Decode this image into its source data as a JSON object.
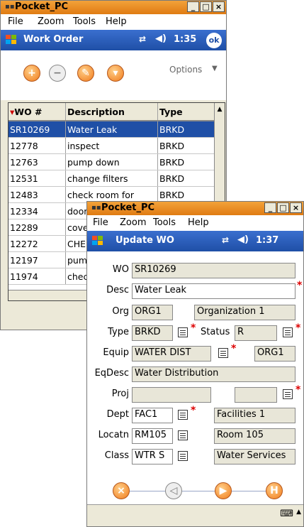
{
  "back_window": {
    "title": "Pocket_PC",
    "menu": [
      "File",
      "Zoom",
      "Tools",
      "Help"
    ],
    "nav_title": "Work Order",
    "time": "1:35",
    "ok_label": "ok",
    "options_label": "Options",
    "columns": [
      "WO #",
      "Description",
      "Type"
    ],
    "rows": [
      {
        "wo": "SR10269",
        "desc": "Water Leak",
        "type": "BRKD"
      },
      {
        "wo": "12778",
        "desc": "inspect",
        "type": "BRKD"
      },
      {
        "wo": "12763",
        "desc": "pump down",
        "type": "BRKD"
      },
      {
        "wo": "12531",
        "desc": "change filters",
        "type": "BRKD"
      },
      {
        "wo": "12483",
        "desc": "check room for",
        "type": "BRKD"
      },
      {
        "wo": "12334",
        "desc": "door",
        "type": ""
      },
      {
        "wo": "12289",
        "desc": "cove",
        "type": ""
      },
      {
        "wo": "12272",
        "desc": "CHE",
        "type": ""
      },
      {
        "wo": "12197",
        "desc": "pum",
        "type": ""
      },
      {
        "wo": "11974",
        "desc": "chec",
        "type": ""
      }
    ],
    "toolbar_icons": [
      "add-icon",
      "remove-icon",
      "edit-icon",
      "filter-icon"
    ]
  },
  "front_window": {
    "title": "Pocket_PC",
    "menu": [
      "File",
      "Zoom",
      "Tools",
      "Help"
    ],
    "nav_title": "Update WO",
    "time": "1:37",
    "fields": {
      "wo": {
        "label": "WO",
        "value": "SR10269"
      },
      "desc": {
        "label": "Desc",
        "value": "Water Leak"
      },
      "org": {
        "label": "Org",
        "value": "ORG1",
        "desc": "Organization 1"
      },
      "type": {
        "label": "Type",
        "value": "BRKD"
      },
      "status": {
        "label": "Status",
        "value": "R"
      },
      "equip": {
        "label": "Equip",
        "value": "WATER DIST",
        "extra": "ORG1"
      },
      "eqdesc": {
        "label": "EqDesc",
        "value": "Water Distribution"
      },
      "proj": {
        "label": "Proj",
        "value": ""
      },
      "dept": {
        "label": "Dept",
        "value": "FAC1",
        "desc": "Facilities 1"
      },
      "locatn": {
        "label": "Locatn",
        "value": "RM105",
        "desc": "Room 105"
      },
      "class": {
        "label": "Class",
        "value": "WTR S",
        "desc": "Water Services"
      }
    },
    "nav_icons": [
      "cancel-icon",
      "back-icon",
      "forward-icon",
      "save-icon"
    ]
  },
  "colors": {
    "titlebar": "#e88a1f",
    "navbar": "#2a5cb8",
    "selection": "#1f4fa6",
    "required": "#dd0000"
  }
}
